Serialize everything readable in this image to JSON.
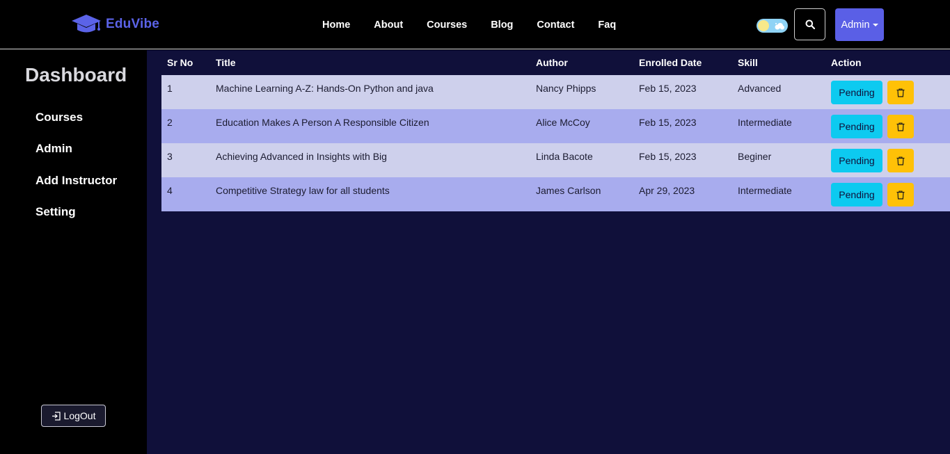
{
  "brand": {
    "name": "EduVibe",
    "color": "#5b63e8"
  },
  "nav": [
    {
      "label": "Home"
    },
    {
      "label": "About"
    },
    {
      "label": "Courses"
    },
    {
      "label": "Blog"
    },
    {
      "label": "Contact"
    },
    {
      "label": "Faq"
    }
  ],
  "header": {
    "admin_label": "Admin",
    "search_icon": "search-icon",
    "theme_toggle": "theme-toggle"
  },
  "sidebar": {
    "title": "Dashboard",
    "items": [
      {
        "label": "Courses"
      },
      {
        "label": "Admin"
      },
      {
        "label": "Add Instructor"
      },
      {
        "label": "Setting"
      }
    ],
    "logout_label": "LogOut"
  },
  "table": {
    "headers": [
      "Sr No",
      "Title",
      "Author",
      "Enrolled Date",
      "Skill",
      "Action"
    ],
    "rows": [
      {
        "sr": "1",
        "title": "Machine Learning A-Z: Hands-On Python and java",
        "author": "Nancy Phipps",
        "date": "Feb 15, 2023",
        "skill": "Advanced",
        "status": "Pending"
      },
      {
        "sr": "2",
        "title": "Education Makes A Person A Responsible Citizen",
        "author": "Alice McCoy",
        "date": "Feb 15, 2023",
        "skill": "Intermediate",
        "status": "Pending"
      },
      {
        "sr": "3",
        "title": "Achieving Advanced in Insights with Big",
        "author": "Linda Bacote",
        "date": "Feb 15, 2023",
        "skill": "Beginer",
        "status": "Pending"
      },
      {
        "sr": "4",
        "title": "Competitive Strategy law for all students",
        "author": "James Carlson",
        "date": "Apr 29, 2023",
        "skill": "Intermediate",
        "status": "Pending"
      }
    ]
  },
  "colors": {
    "main_bg": "#10103a",
    "row_light": "#ced0ec",
    "row_dark": "#a8acee",
    "pending": "#0dcaf0",
    "delete": "#ffc107",
    "admin_button": "#5a5fe6"
  }
}
